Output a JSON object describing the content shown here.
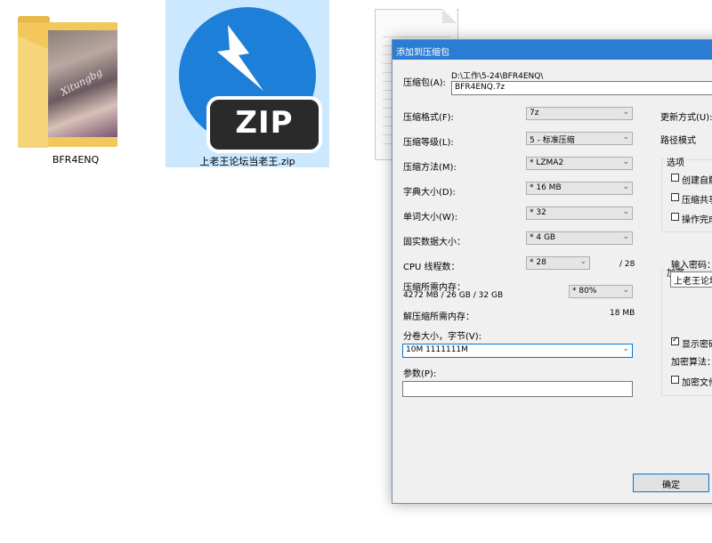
{
  "desktop": {
    "items": [
      {
        "label": "BFR4ENQ",
        "type": "folder",
        "watermark": "Xitungbg"
      },
      {
        "label": "上老王论坛当老王.zip",
        "type": "zip",
        "icon_text": "ZIP"
      },
      {
        "label": "",
        "type": "document"
      }
    ]
  },
  "dialog": {
    "title": "添加到压缩包",
    "archive_label": "压缩包(A):",
    "archive_path": "D:\\工作\\5-24\\BFR4ENQ\\",
    "archive_name": "BFR4ENQ.7z",
    "format_label": "压缩格式(F):",
    "format_value": "7z",
    "level_label": "压缩等级(L):",
    "level_value": "5 - 标准压缩",
    "method_label": "压缩方法(M):",
    "method_value": "* LZMA2",
    "dict_label": "字典大小(D):",
    "dict_value": "* 16 MB",
    "word_label": "单词大小(W):",
    "word_value": "* 32",
    "solid_label": "固实数据大小：",
    "solid_value": "* 4 GB",
    "cpu_label": "CPU 线程数：",
    "cpu_value": "* 28",
    "cpu_total": "/ 28",
    "mem_label": "压缩所需内存：",
    "mem_detail": "4272 MB / 26 GB / 32 GB",
    "mem_value": "* 80%",
    "decomp_label": "解压缩所需内存：",
    "decomp_value": "18 MB",
    "split_label": "分卷大小，字节(V):",
    "split_value": "10M 1111111M",
    "params_label": "参数(P):",
    "params_value": "",
    "update_label": "更新方式(U):",
    "path_mode_label": "路径模式",
    "options_title": "选项",
    "options": [
      {
        "label": "创建自解",
        "checked": false
      },
      {
        "label": "压缩共享",
        "checked": false
      },
      {
        "label": "操作完成",
        "checked": false
      }
    ],
    "encrypt_title": "加密",
    "password_label": "输入密码：",
    "password_value": "上老王论坛",
    "show_password_label": "显示密码",
    "show_password_checked": true,
    "encrypt_method_label": "加密算法：",
    "encrypt_names_label": "加密文件",
    "encrypt_names_checked": false,
    "ok_label": "确定"
  }
}
